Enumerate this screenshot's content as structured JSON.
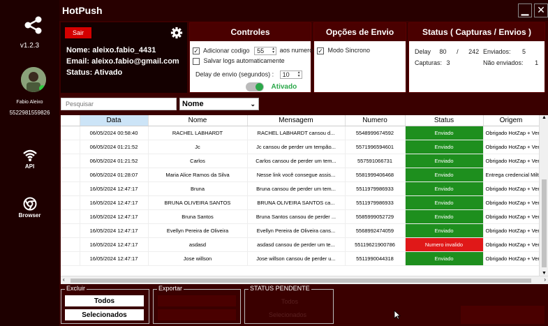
{
  "app": {
    "title": "HotPush",
    "minimize": "▁",
    "close": "✕"
  },
  "sidebar": {
    "version": "v1.2.3",
    "user_name": "Fabio Aleixo",
    "user_phone": "5522981559826",
    "nav": [
      {
        "label": "API",
        "icon": "wifi-icon"
      },
      {
        "label": "Browser",
        "icon": "chrome-icon"
      }
    ]
  },
  "user": {
    "logout": "Sair",
    "name": "Nome: aleixo.fabio_4431",
    "email": "Email: aleixo.fabio@gmail.com",
    "status": "Status: Ativado"
  },
  "controles": {
    "title": "Controles",
    "add_code_label": "Adicionar codigo",
    "add_code_checked": true,
    "add_code_value": "55",
    "add_code_suffix": "aos numeros",
    "save_logs_label": "Salvar logs automaticamente",
    "save_logs_checked": false,
    "delay_label": "Delay  de envio (segundos) :",
    "delay_value": "10",
    "toggle_label": "Ativado"
  },
  "opcoes": {
    "title": "Opções de Envio",
    "sync_label": "Modo Sincrono",
    "sync_checked": true
  },
  "status": {
    "title": "Status ( Capturas / Envios )",
    "delay_label": "Delay",
    "delay_value": "80",
    "sep": "/",
    "delay_total": "242",
    "captures_label": "Capturas:",
    "captures_value": "3",
    "sent_label": "Enviados:",
    "sent_value": "5",
    "unsent_label": "Não enviados:",
    "unsent_value": "1"
  },
  "search": {
    "placeholder": "Pesquisar"
  },
  "filter": {
    "selected": "Nome"
  },
  "table": {
    "columns": [
      "Data",
      "Nome",
      "Mensagem",
      "Numero",
      "Status",
      "Origem"
    ],
    "rows": [
      [
        "06/05/2024 00:58:40",
        "RACHEL LABHARDT",
        "RACHEL LABHARDT cansou d...",
        "5548999674592",
        "Enviado",
        "Obrigado HotZap + Venda Multi..."
      ],
      [
        "06/05/2024 01:21:52",
        "Jc",
        "Jc cansou de perder um tempão...",
        "5571996594601",
        "Enviado",
        "Obrigado HotZap + Venda Multi..."
      ],
      [
        "06/05/2024 01:21:52",
        "Carlos",
        "Carlos cansou de perder um tem...",
        "557591066731",
        "Enviado",
        "Obrigado HotZap + Venda Multi..."
      ],
      [
        "06/05/2024 01:28:07",
        "Maria Alice Ramos da Silva",
        "Nesse link você consegue assis...",
        "5581999406468",
        "Enviado",
        "Entrega credencial MiltiSender"
      ],
      [
        "16/05/2024 12:47:17",
        "Bruna",
        "Bruna cansou de perder um tem...",
        "5511979986933",
        "Enviado",
        "Obrigado HotZap + Venda Multi..."
      ],
      [
        "16/05/2024 12:47:17",
        "BRUNA OLIVEIRA SANTOS",
        "BRUNA OLIVEIRA SANTOS ca...",
        "5511979986933",
        "Enviado",
        "Obrigado HotZap + Venda Multi..."
      ],
      [
        "16/05/2024 12:47:17",
        "Bruna Santos",
        "Bruna Santos cansou de perder ...",
        "5585999052729",
        "Enviado",
        "Obrigado HotZap + Venda Multi..."
      ],
      [
        "16/05/2024 12:47:17",
        "Evellyn Pereira de Oliveira",
        "Evellyn Pereira de Oliveira cans...",
        "5568992474059",
        "Enviado",
        "Obrigado HotZap + Venda Multi..."
      ],
      [
        "16/05/2024 12:47:17",
        "asdasd",
        "asdasd cansou de perder um te...",
        "55119621900786",
        "Numero invalido",
        "Obrigado HotZap + Venda Multi..."
      ],
      [
        "16/05/2024 12:47:17",
        "Jose willson",
        "Jose willson cansou de perder u...",
        "5511990044318",
        "Enviado",
        "Obrigado HotZap + Venda Multi..."
      ]
    ]
  },
  "excluir": {
    "title": "Excluir",
    "all": "Todos",
    "selected": "Selecionados"
  },
  "exportar": {
    "title": "Exportar"
  },
  "pendente": {
    "title": "STATUS PENDENTE",
    "all": "Todos",
    "selected": "Selecionados"
  },
  "colors": {
    "ok": "#1e8f1e",
    "bad": "#e01818",
    "accent": "#d40000"
  }
}
